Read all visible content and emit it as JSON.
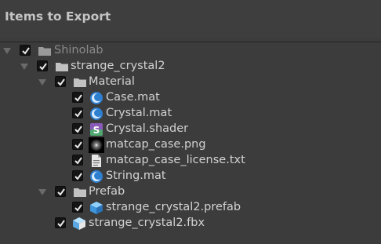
{
  "header": {
    "title": "Items to Export"
  },
  "tree": [
    {
      "label": "Shinolab",
      "icon": "folder-icon",
      "checked": true,
      "expanded": true,
      "dim": true
    },
    {
      "label": "strange_crystal2",
      "icon": "folder-icon",
      "checked": true,
      "expanded": true
    },
    {
      "label": "Material",
      "icon": "folder-icon",
      "checked": true,
      "expanded": true
    },
    {
      "label": "Case.mat",
      "icon": "material-icon",
      "checked": true
    },
    {
      "label": "Crystal.mat",
      "icon": "material-icon",
      "checked": true
    },
    {
      "label": "Crystal.shader",
      "icon": "shader-icon",
      "checked": true
    },
    {
      "label": "matcap_case.png",
      "icon": "texture-icon",
      "checked": true
    },
    {
      "label": "matcap_case_license.txt",
      "icon": "text-file-icon",
      "checked": true
    },
    {
      "label": "String.mat",
      "icon": "material-icon",
      "checked": true
    },
    {
      "label": "Prefab",
      "icon": "folder-icon",
      "checked": true,
      "expanded": true
    },
    {
      "label": "strange_crystal2.prefab",
      "icon": "prefab-icon",
      "checked": true
    },
    {
      "label": "strange_crystal2.fbx",
      "icon": "model-icon",
      "checked": true
    }
  ],
  "colors": {
    "background": "#3c3c3c",
    "folder": "#c2c2c2",
    "material": "#2f7fd0",
    "shader_badge": "#8a5ab8",
    "prefab": "#4aa3e8"
  }
}
